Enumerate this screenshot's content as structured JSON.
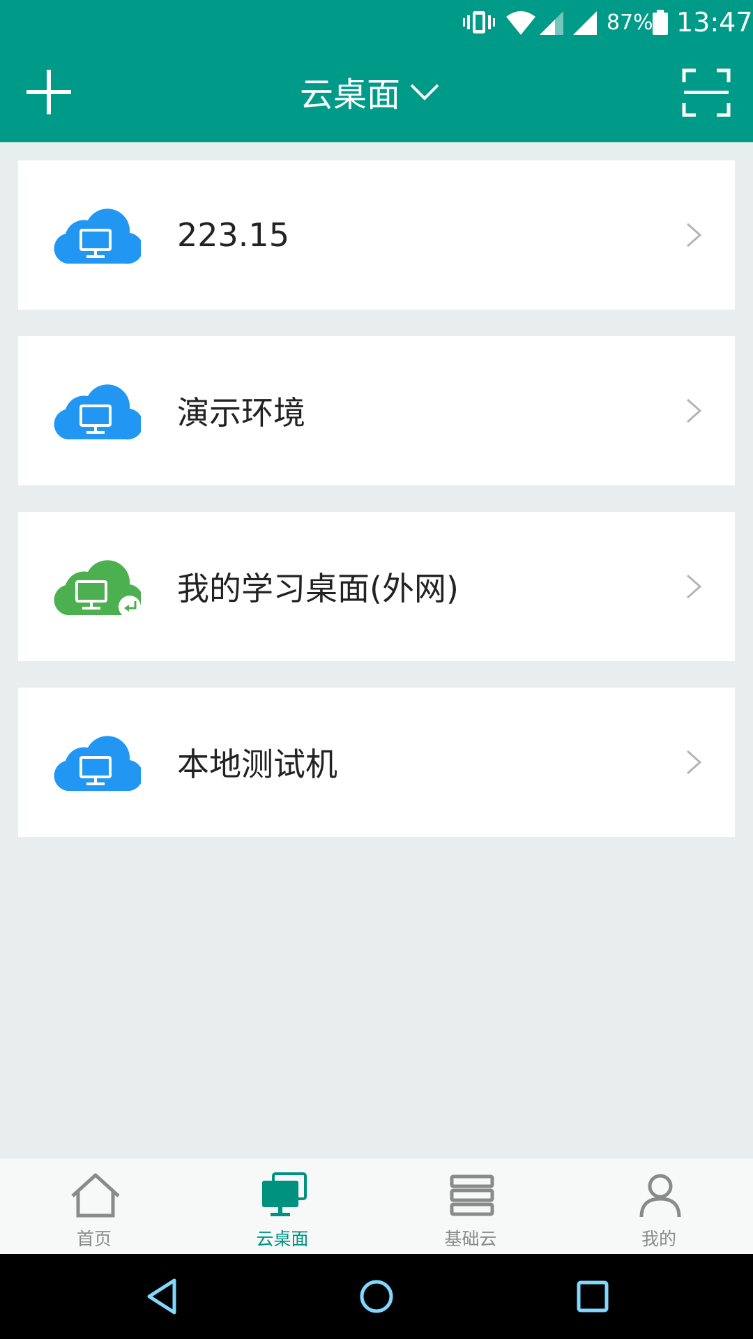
{
  "status_bar": {
    "battery_percent": "87%",
    "time": "13:47",
    "icons": [
      "vibrate-icon",
      "wifi-icon",
      "signal-icon",
      "signal-icon",
      "battery-icon"
    ]
  },
  "header": {
    "title": "云桌面",
    "left_icon": "add-icon",
    "right_icon": "scan-icon",
    "color": "#009a88"
  },
  "desktops": [
    {
      "label": "223.15",
      "icon": "cloud-desktop-icon",
      "color": "#2196f3",
      "arrow_icon": "chevron-right-icon"
    },
    {
      "label": "演示环境",
      "icon": "cloud-desktop-icon",
      "color": "#2196f3",
      "arrow_icon": "chevron-right-icon"
    },
    {
      "label": "我的学习桌面(外网)",
      "icon": "cloud-desktop-shared-icon",
      "color": "#4caf50",
      "arrow_icon": "chevron-right-icon"
    },
    {
      "label": "本地测试机",
      "icon": "cloud-desktop-icon",
      "color": "#2196f3",
      "arrow_icon": "chevron-right-icon"
    }
  ],
  "tabs": [
    {
      "label": "首页",
      "icon": "home-icon",
      "active": false
    },
    {
      "label": "云桌面",
      "icon": "desktop-icon",
      "active": true
    },
    {
      "label": "基础云",
      "icon": "server-icon",
      "active": false
    },
    {
      "label": "我的",
      "icon": "user-icon",
      "active": false
    }
  ],
  "tab_active_color": "#00927f",
  "nav_bar": {
    "buttons": [
      "back-icon",
      "home-circle-icon",
      "recents-icon"
    ]
  }
}
